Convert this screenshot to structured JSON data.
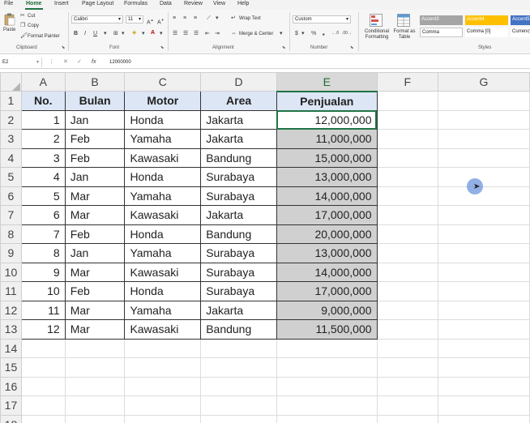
{
  "ribbon_tabs": [
    "File",
    "Home",
    "Insert",
    "Page Layout",
    "Formulas",
    "Data",
    "Review",
    "View",
    "Help"
  ],
  "clipboard": {
    "paste": "Paste",
    "cut": "Cut",
    "copy": "Copy",
    "format_painter": "Format Painter",
    "label": "Clipboard"
  },
  "font": {
    "name": "Calibri",
    "size": "11",
    "label": "Font"
  },
  "alignment": {
    "wrap_text": "Wrap Text",
    "merge_center": "Merge & Center",
    "label": "Alignment"
  },
  "number": {
    "format": "Custom",
    "label": "Number"
  },
  "styles": {
    "conditional_formatting": "Conditional Formatting",
    "format_as_table": "Format as Table",
    "cells": [
      "Accent3",
      "Accent4",
      "Accent5",
      "Comma",
      "Comma [0]",
      "Currency"
    ],
    "label": "Styles"
  },
  "formula_bar": {
    "name_box": "E2",
    "value": "12000000"
  },
  "columns": [
    "A",
    "B",
    "C",
    "D",
    "E",
    "F",
    "G"
  ],
  "rows": [
    "1",
    "2",
    "3",
    "4",
    "5",
    "6",
    "7",
    "8",
    "9",
    "10",
    "11",
    "12",
    "13",
    "14",
    "15",
    "16",
    "17",
    "18"
  ],
  "table": {
    "headers": [
      "No.",
      "Bulan",
      "Motor",
      "Area",
      "Penjualan"
    ],
    "rows": [
      [
        "1",
        "Jan",
        "Honda",
        "Jakarta",
        "12,000,000"
      ],
      [
        "2",
        "Feb",
        "Yamaha",
        "Jakarta",
        "11,000,000"
      ],
      [
        "3",
        "Feb",
        "Kawasaki",
        "Bandung",
        "15,000,000"
      ],
      [
        "4",
        "Jan",
        "Honda",
        "Surabaya",
        "13,000,000"
      ],
      [
        "5",
        "Mar",
        "Yamaha",
        "Surabaya",
        "14,000,000"
      ],
      [
        "6",
        "Mar",
        "Kawasaki",
        "Jakarta",
        "17,000,000"
      ],
      [
        "7",
        "Feb",
        "Honda",
        "Bandung",
        "20,000,000"
      ],
      [
        "8",
        "Jan",
        "Yamaha",
        "Surabaya",
        "13,000,000"
      ],
      [
        "9",
        "Mar",
        "Kawasaki",
        "Surabaya",
        "14,000,000"
      ],
      [
        "10",
        "Feb",
        "Honda",
        "Surabaya",
        "17,000,000"
      ],
      [
        "11",
        "Mar",
        "Yamaha",
        "Jakarta",
        "9,000,000"
      ],
      [
        "12",
        "Mar",
        "Kawasaki",
        "Bandung",
        "11,500,000"
      ]
    ]
  },
  "colors": {
    "accent": "#217346",
    "header_fill": "#dce6f5",
    "selected_fill": "#d0d0d0"
  }
}
